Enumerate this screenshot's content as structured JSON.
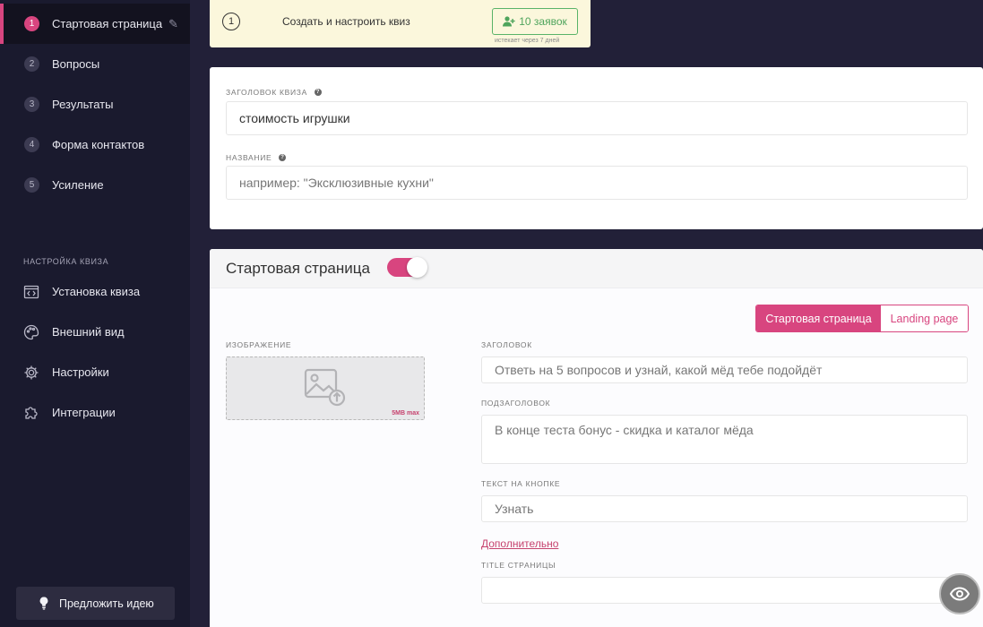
{
  "sidebar": {
    "steps": [
      {
        "num": "1",
        "label": "Стартовая страница"
      },
      {
        "num": "2",
        "label": "Вопросы"
      },
      {
        "num": "3",
        "label": "Результаты"
      },
      {
        "num": "4",
        "label": "Форма контактов"
      },
      {
        "num": "5",
        "label": "Усиление"
      }
    ],
    "section_title": "НАСТРОЙКА КВИЗА",
    "settings": [
      {
        "label": "Установка квиза",
        "icon": "code-window-icon"
      },
      {
        "label": "Внешний вид",
        "icon": "palette-icon"
      },
      {
        "label": "Настройки",
        "icon": "gear-icon"
      },
      {
        "label": "Интеграции",
        "icon": "puzzle-icon"
      }
    ],
    "idea_button": "Предложить идею"
  },
  "notice": {
    "step": "1",
    "text": "Создать и настроить квиз",
    "requests_button": "10 заявок",
    "expires": "истекает через 7 дней"
  },
  "quiz_form": {
    "title_label": "ЗАГОЛОВОК КВИЗА",
    "title_value": "стоимость игрушки",
    "name_label": "НАЗВАНИЕ",
    "name_placeholder": "например: \"Эксклюзивные кухни\""
  },
  "start_page": {
    "heading": "Стартовая страница",
    "toggle_on": true,
    "tabs": [
      "Стартовая страница",
      "Landing page"
    ],
    "image_label": "ИЗОБРАЖЕНИЕ",
    "image_max": "5MB max",
    "heading_label": "ЗАГОЛОВОК",
    "heading_placeholder": "Ответь на 5 вопросов и узнай, какой мёд тебе подойдёт",
    "subheading_label": "ПОДЗАГОЛОВОК",
    "subheading_placeholder": "В конце теста бонус - скидка и каталог мёда",
    "button_text_label": "ТЕКСТ НА КНОПКЕ",
    "button_text_placeholder": "Узнать",
    "more_link": "Дополнительно",
    "page_title_label": "TITLE СТРАНИЦЫ",
    "page_title_value": ""
  },
  "colors": {
    "accent": "#d8457f",
    "sidebar": "#1a1a2e",
    "success": "#59b368"
  }
}
